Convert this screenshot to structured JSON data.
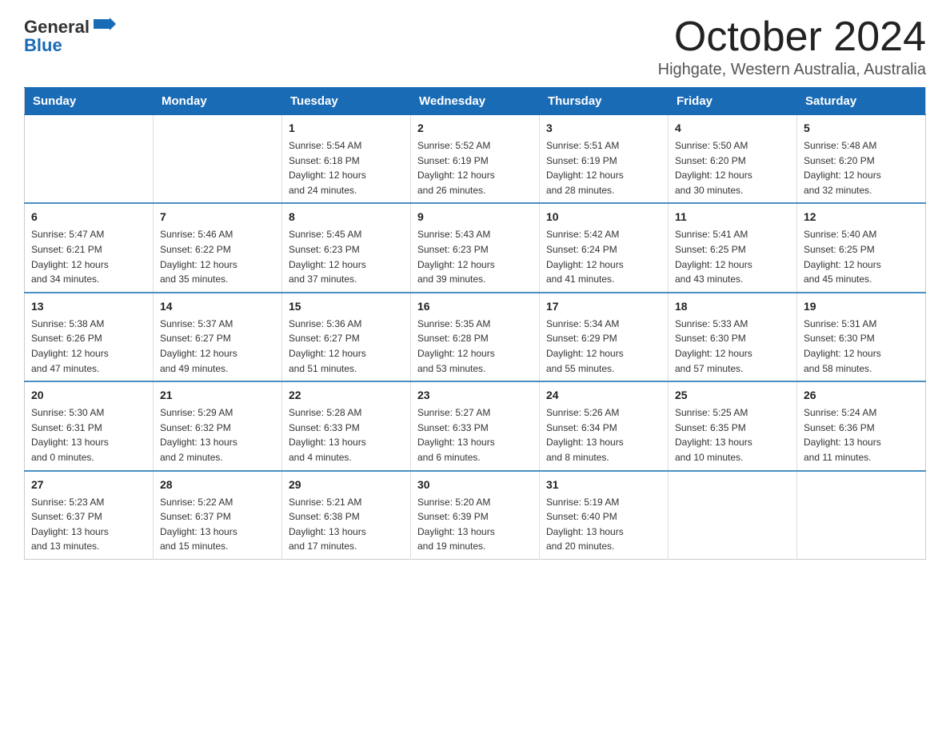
{
  "header": {
    "logo": {
      "text_general": "General",
      "text_blue": "Blue",
      "icon_alt": "GeneralBlue logo"
    },
    "title": "October 2024",
    "location": "Highgate, Western Australia, Australia"
  },
  "calendar": {
    "days_of_week": [
      "Sunday",
      "Monday",
      "Tuesday",
      "Wednesday",
      "Thursday",
      "Friday",
      "Saturday"
    ],
    "weeks": [
      [
        {
          "day": "",
          "info": ""
        },
        {
          "day": "",
          "info": ""
        },
        {
          "day": "1",
          "info": "Sunrise: 5:54 AM\nSunset: 6:18 PM\nDaylight: 12 hours\nand 24 minutes."
        },
        {
          "day": "2",
          "info": "Sunrise: 5:52 AM\nSunset: 6:19 PM\nDaylight: 12 hours\nand 26 minutes."
        },
        {
          "day": "3",
          "info": "Sunrise: 5:51 AM\nSunset: 6:19 PM\nDaylight: 12 hours\nand 28 minutes."
        },
        {
          "day": "4",
          "info": "Sunrise: 5:50 AM\nSunset: 6:20 PM\nDaylight: 12 hours\nand 30 minutes."
        },
        {
          "day": "5",
          "info": "Sunrise: 5:48 AM\nSunset: 6:20 PM\nDaylight: 12 hours\nand 32 minutes."
        }
      ],
      [
        {
          "day": "6",
          "info": "Sunrise: 5:47 AM\nSunset: 6:21 PM\nDaylight: 12 hours\nand 34 minutes."
        },
        {
          "day": "7",
          "info": "Sunrise: 5:46 AM\nSunset: 6:22 PM\nDaylight: 12 hours\nand 35 minutes."
        },
        {
          "day": "8",
          "info": "Sunrise: 5:45 AM\nSunset: 6:23 PM\nDaylight: 12 hours\nand 37 minutes."
        },
        {
          "day": "9",
          "info": "Sunrise: 5:43 AM\nSunset: 6:23 PM\nDaylight: 12 hours\nand 39 minutes."
        },
        {
          "day": "10",
          "info": "Sunrise: 5:42 AM\nSunset: 6:24 PM\nDaylight: 12 hours\nand 41 minutes."
        },
        {
          "day": "11",
          "info": "Sunrise: 5:41 AM\nSunset: 6:25 PM\nDaylight: 12 hours\nand 43 minutes."
        },
        {
          "day": "12",
          "info": "Sunrise: 5:40 AM\nSunset: 6:25 PM\nDaylight: 12 hours\nand 45 minutes."
        }
      ],
      [
        {
          "day": "13",
          "info": "Sunrise: 5:38 AM\nSunset: 6:26 PM\nDaylight: 12 hours\nand 47 minutes."
        },
        {
          "day": "14",
          "info": "Sunrise: 5:37 AM\nSunset: 6:27 PM\nDaylight: 12 hours\nand 49 minutes."
        },
        {
          "day": "15",
          "info": "Sunrise: 5:36 AM\nSunset: 6:27 PM\nDaylight: 12 hours\nand 51 minutes."
        },
        {
          "day": "16",
          "info": "Sunrise: 5:35 AM\nSunset: 6:28 PM\nDaylight: 12 hours\nand 53 minutes."
        },
        {
          "day": "17",
          "info": "Sunrise: 5:34 AM\nSunset: 6:29 PM\nDaylight: 12 hours\nand 55 minutes."
        },
        {
          "day": "18",
          "info": "Sunrise: 5:33 AM\nSunset: 6:30 PM\nDaylight: 12 hours\nand 57 minutes."
        },
        {
          "day": "19",
          "info": "Sunrise: 5:31 AM\nSunset: 6:30 PM\nDaylight: 12 hours\nand 58 minutes."
        }
      ],
      [
        {
          "day": "20",
          "info": "Sunrise: 5:30 AM\nSunset: 6:31 PM\nDaylight: 13 hours\nand 0 minutes."
        },
        {
          "day": "21",
          "info": "Sunrise: 5:29 AM\nSunset: 6:32 PM\nDaylight: 13 hours\nand 2 minutes."
        },
        {
          "day": "22",
          "info": "Sunrise: 5:28 AM\nSunset: 6:33 PM\nDaylight: 13 hours\nand 4 minutes."
        },
        {
          "day": "23",
          "info": "Sunrise: 5:27 AM\nSunset: 6:33 PM\nDaylight: 13 hours\nand 6 minutes."
        },
        {
          "day": "24",
          "info": "Sunrise: 5:26 AM\nSunset: 6:34 PM\nDaylight: 13 hours\nand 8 minutes."
        },
        {
          "day": "25",
          "info": "Sunrise: 5:25 AM\nSunset: 6:35 PM\nDaylight: 13 hours\nand 10 minutes."
        },
        {
          "day": "26",
          "info": "Sunrise: 5:24 AM\nSunset: 6:36 PM\nDaylight: 13 hours\nand 11 minutes."
        }
      ],
      [
        {
          "day": "27",
          "info": "Sunrise: 5:23 AM\nSunset: 6:37 PM\nDaylight: 13 hours\nand 13 minutes."
        },
        {
          "day": "28",
          "info": "Sunrise: 5:22 AM\nSunset: 6:37 PM\nDaylight: 13 hours\nand 15 minutes."
        },
        {
          "day": "29",
          "info": "Sunrise: 5:21 AM\nSunset: 6:38 PM\nDaylight: 13 hours\nand 17 minutes."
        },
        {
          "day": "30",
          "info": "Sunrise: 5:20 AM\nSunset: 6:39 PM\nDaylight: 13 hours\nand 19 minutes."
        },
        {
          "day": "31",
          "info": "Sunrise: 5:19 AM\nSunset: 6:40 PM\nDaylight: 13 hours\nand 20 minutes."
        },
        {
          "day": "",
          "info": ""
        },
        {
          "day": "",
          "info": ""
        }
      ]
    ]
  },
  "colors": {
    "header_bg": "#1a6bb5",
    "header_text": "#ffffff",
    "border": "#cccccc",
    "row_border": "#4a90c4"
  }
}
